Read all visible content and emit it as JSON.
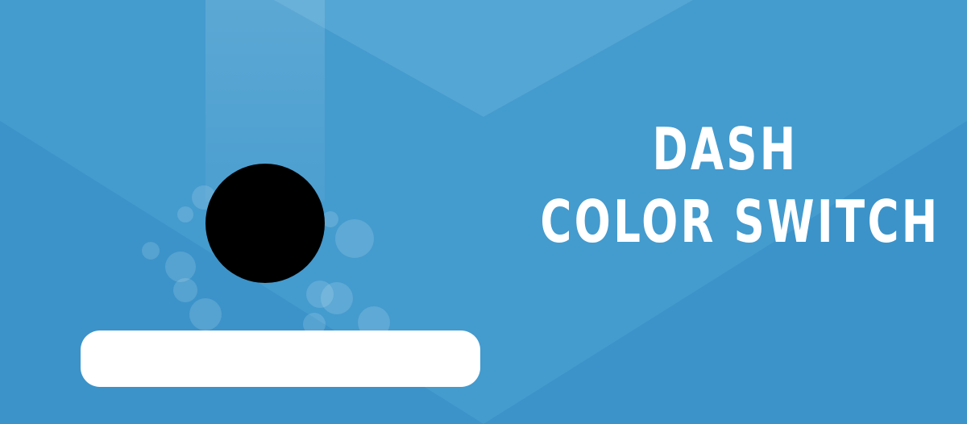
{
  "game": {
    "title_line1": "DASH",
    "title_line2": "COLOR SWITCH"
  },
  "colors": {
    "background": "#3c95ca",
    "ball": "#000000",
    "paddle": "#ffffff",
    "text": "#ffffff"
  }
}
